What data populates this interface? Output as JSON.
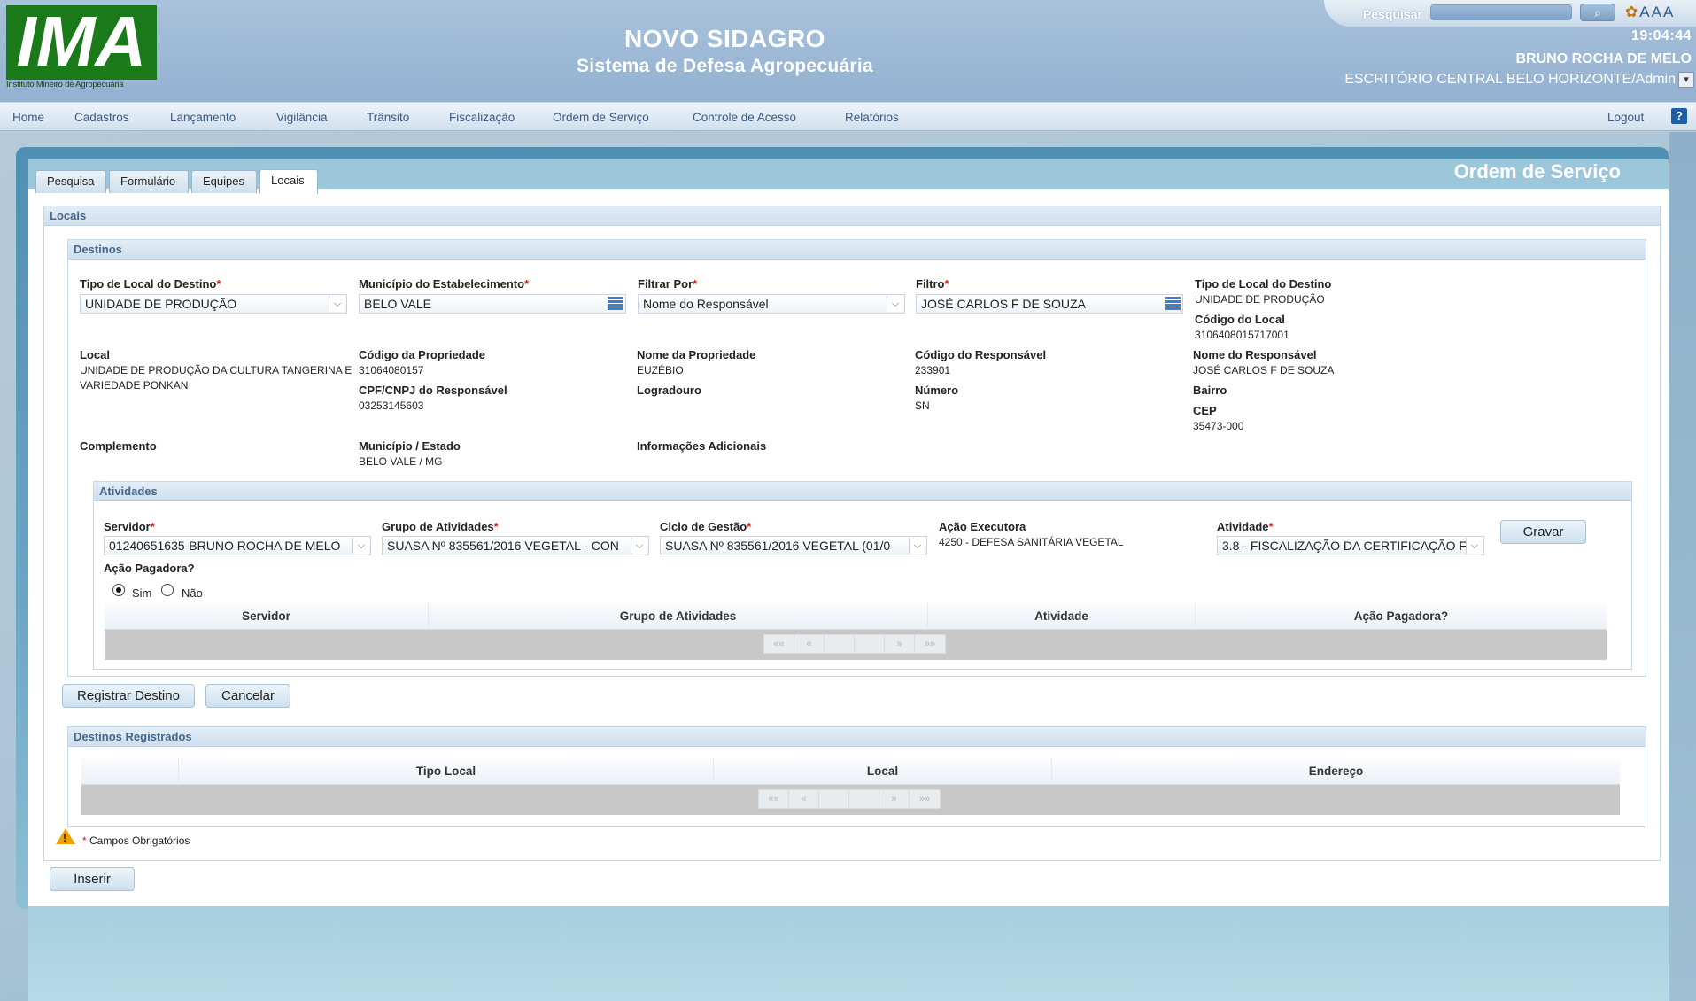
{
  "header": {
    "logo_text": "IMA",
    "logo_caption": "Instituto Mineiro de Agropecuária",
    "system_title": "NOVO SIDAGRO",
    "system_subtitle": "Sistema de Defesa Agropecuária",
    "search_label": "Pesquisar",
    "search_value": "",
    "clock": "19:04:44",
    "user_name": "BRUNO ROCHA DE MELO",
    "office": "ESCRITÓRIO CENTRAL BELO HORIZONTE/Admin",
    "font_tools": [
      "A",
      "A",
      "A"
    ]
  },
  "menu": {
    "items": [
      "Home",
      "Cadastros",
      "Lançamento",
      "Vigilância",
      "Trânsito",
      "Fiscalização",
      "Ordem de Serviço",
      "Controle de Acesso",
      "Relatórios"
    ],
    "logout": "Logout",
    "help": "?"
  },
  "page": {
    "title": "Ordem de Serviço",
    "tabs": [
      "Pesquisa",
      "Formulário",
      "Equipes",
      "Locais"
    ],
    "active_tab": "Locais",
    "section_title": "Locais"
  },
  "destinos": {
    "title": "Destinos",
    "tipo_local_label": "Tipo de Local do Destino",
    "tipo_local_value": "UNIDADE DE PRODUÇÃO",
    "municipio_label": "Município do Estabelecimento",
    "municipio_value": "BELO VALE",
    "filtrar_por_label": "Filtrar Por",
    "filtrar_por_value": "Nome do Responsável",
    "filtro_label": "Filtro",
    "filtro_value": "JOSÉ CARLOS F DE SOUZA",
    "info_tipo_local_label": "Tipo de Local do Destino",
    "info_tipo_local_value": "UNIDADE DE PRODUÇÃO",
    "codigo_local_label": "Código do Local",
    "codigo_local_value": "3106408015717001",
    "local_label": "Local",
    "local_value": "UNIDADE DE PRODUÇÃO DA CULTURA TANGERINA E VARIEDADE PONKAN",
    "codigo_propriedade_label": "Código da Propriedade",
    "codigo_propriedade_value": "31064080157",
    "cpf_label": "CPF/CNPJ do Responsável",
    "cpf_value": "03253145603",
    "nome_propriedade_label": "Nome da Propriedade",
    "nome_propriedade_value": "EUZÉBIO",
    "logradouro_label": "Logradouro",
    "codigo_responsavel_label": "Código do Responsável",
    "codigo_responsavel_value": "233901",
    "numero_label": "Número",
    "numero_value": "SN",
    "nome_responsavel_label": "Nome do Responsável",
    "nome_responsavel_value": "JOSÉ CARLOS F DE SOUZA",
    "bairro_label": "Bairro",
    "cep_label": "CEP",
    "cep_value": "35473-000",
    "complemento_label": "Complemento",
    "municipio_estado_label": "Município / Estado",
    "municipio_estado_value": "BELO VALE / MG",
    "info_adicionais_label": "Informações Adicionais"
  },
  "atividades": {
    "title": "Atividades",
    "servidor_label": "Servidor",
    "servidor_value": "01240651635-BRUNO ROCHA DE MELO",
    "grupo_label": "Grupo de Atividades",
    "grupo_value": "SUASA Nº 835561/2016 VEGETAL - CON",
    "ciclo_label": "Ciclo de Gestão",
    "ciclo_value": "SUASA Nº 835561/2016 VEGETAL (01/0",
    "acao_executora_label": "Ação Executora",
    "acao_executora_value": "4250 - DEFESA SANITÁRIA VEGETAL",
    "atividade_label": "Atividade",
    "atividade_value": "3.8 - FISCALIZAÇÃO DA CERTIFICAÇÃO F",
    "gravar": "Gravar",
    "acao_pagadora_label": "Ação Pagadora?",
    "sim": "Sim",
    "nao": "Não",
    "grid_columns": [
      "Servidor",
      "Grupo de Atividades",
      "Atividade",
      "Ação Pagadora?"
    ],
    "pager": [
      "««",
      "«",
      "",
      "",
      "»",
      "»»"
    ]
  },
  "actions": {
    "registrar": "Registrar Destino",
    "cancelar": "Cancelar",
    "inserir": "Inserir"
  },
  "registrados": {
    "title": "Destinos Registrados",
    "grid_columns": [
      "Tipo Local",
      "Local",
      "Endereço"
    ],
    "pager": [
      "««",
      "«",
      "",
      "",
      "»",
      "»»"
    ]
  },
  "legend": {
    "required_mark": "*",
    "required_text": "Campos Obrigatórios"
  }
}
